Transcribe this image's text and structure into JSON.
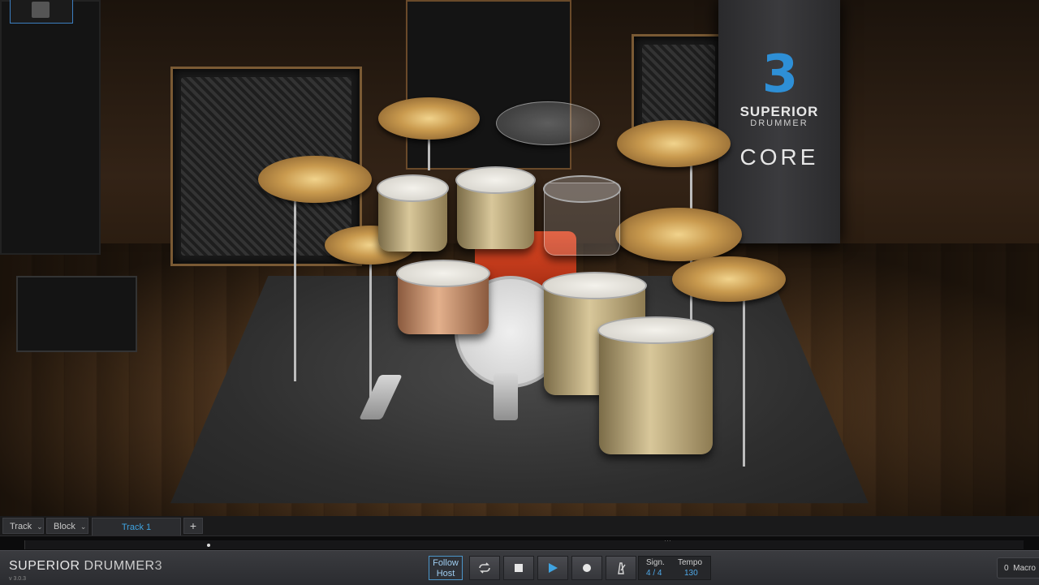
{
  "app": {
    "title": "SUPERIOR DRUMMER 3",
    "logo_main": "SUPERIOR",
    "logo_sub": "DRUMMER",
    "logo_num": "3",
    "version": "v 3.0.3"
  },
  "banner": {
    "number": "3",
    "line1": "SUPERIOR",
    "line2": "DRUMMER",
    "line3": "CORE"
  },
  "tabs": {
    "track_label": "Track",
    "block_label": "Block",
    "active_tab": "Track 1",
    "add_label": "+"
  },
  "transport": {
    "follow_line1": "Follow",
    "follow_line2": "Host",
    "sign_label": "Sign.",
    "sign_value": "4 / 4",
    "tempo_label": "Tempo",
    "tempo_value": "130",
    "buttons": [
      "loop-icon",
      "stop-icon",
      "play-icon",
      "record-icon",
      "metronome-icon"
    ]
  },
  "macro": {
    "count": "0",
    "label": "Macro"
  },
  "colors": {
    "accent": "#3fa3e0",
    "logo_blue": "#2e8fd6"
  }
}
